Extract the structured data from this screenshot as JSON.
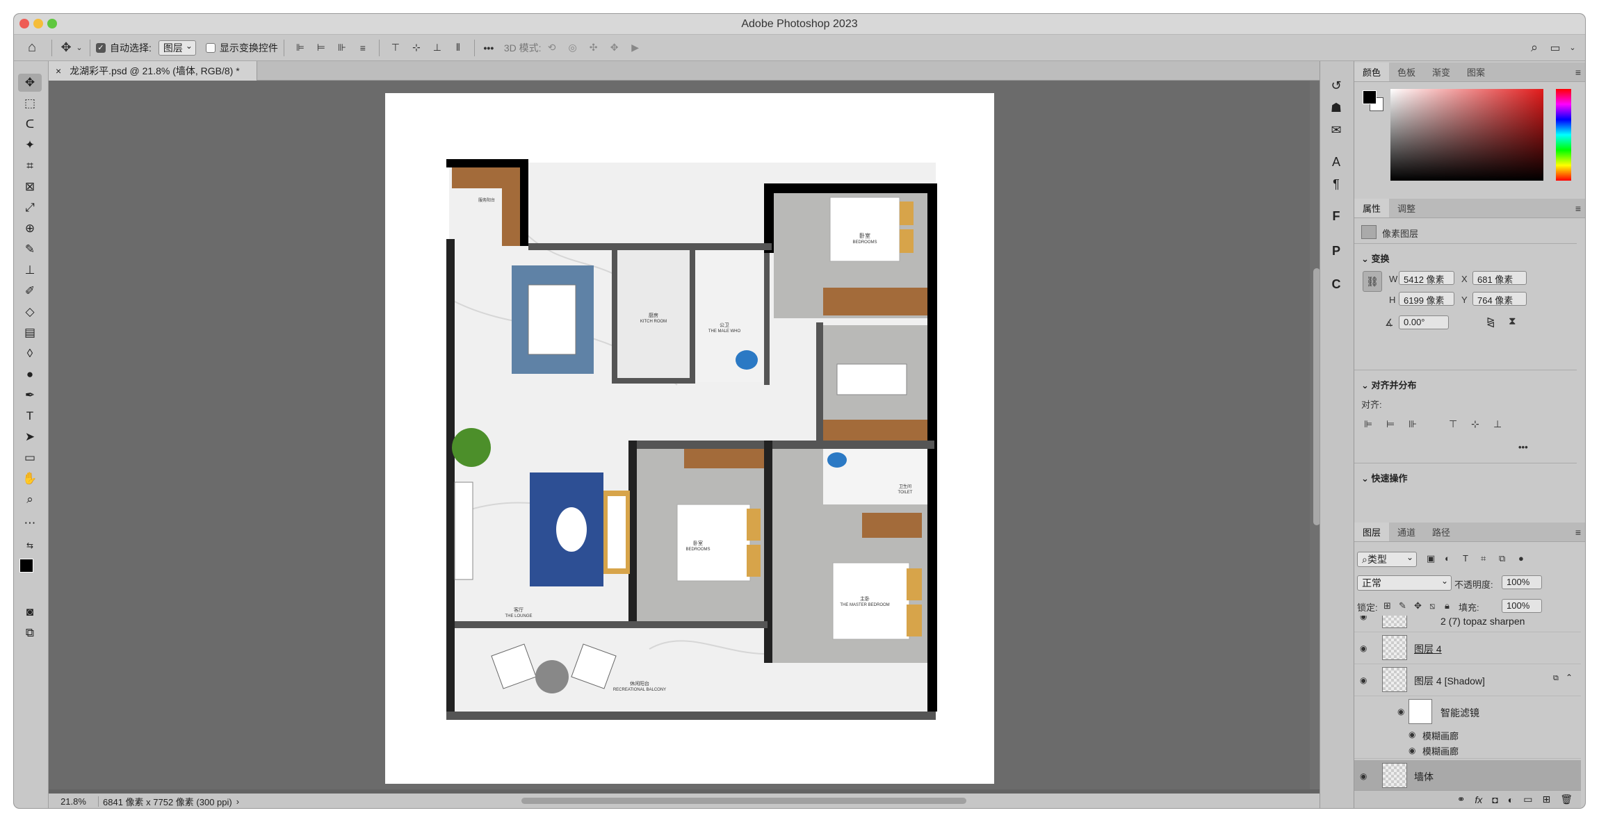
{
  "app": {
    "title": "Adobe Photoshop 2023"
  },
  "options_bar": {
    "auto_select_label": "自动选择:",
    "auto_select_value": "图层",
    "show_transform_label": "显示变换控件",
    "mode_3d_label": "3D 模式:",
    "more": "•••"
  },
  "document": {
    "tab_label": "龙湖彩平.psd @ 21.8% (墙体, RGB/8) *",
    "close": "×"
  },
  "status": {
    "zoom": "21.8%",
    "info": "6841 像素 x 7752 像素 (300 ppi)"
  },
  "floorplan": {
    "rooms": [
      {
        "cn": "卧室",
        "en": "BEDROOMS"
      },
      {
        "cn": "厨房",
        "en": "KITCH ROOM"
      },
      {
        "cn": "公卫",
        "en": "THE MALE WHO"
      },
      {
        "cn": "卧室",
        "en": "BEDROOMS"
      },
      {
        "cn": "卫生间",
        "en": "TOILET"
      },
      {
        "cn": "主卧",
        "en": "THE MASTER BEDROOM"
      },
      {
        "cn": "客厅",
        "en": "THE LOUNGE"
      },
      {
        "cn": "休闲阳台",
        "en": "RECREATIONAL BALCONY"
      },
      {
        "cn": "服务阳台",
        "en": ""
      }
    ]
  },
  "color_panel": {
    "tabs": [
      "颜色",
      "色板",
      "渐变",
      "图案"
    ]
  },
  "properties_panel": {
    "tabs": [
      "属性",
      "调整"
    ],
    "layer_type": "像素图层",
    "transform_title": "变换",
    "w_label": "W",
    "w_value": "5412 像素",
    "h_label": "H",
    "h_value": "6199 像素",
    "x_label": "X",
    "x_value": "681 像素",
    "y_label": "Y",
    "y_value": "764 像素",
    "angle_value": "0.00°",
    "align_title": "对齐并分布",
    "align_label": "对齐:",
    "more": "•••",
    "quick_title": "快速操作"
  },
  "layers_panel": {
    "tabs": [
      "图层",
      "通道",
      "路径"
    ],
    "filter_kind": "类型",
    "blend_mode": "正常",
    "opacity_label": "不透明度:",
    "opacity_value": "100%",
    "lock_label": "锁定:",
    "fill_label": "填充:",
    "fill_value": "100%",
    "layers": [
      {
        "name": "2 (7) topaz sharpen"
      },
      {
        "name": "图层 4"
      },
      {
        "name": "图层 4 [Shadow]"
      },
      {
        "name": "智能滤镜"
      },
      {
        "name": "模糊画廊"
      },
      {
        "name": "模糊画廊"
      },
      {
        "name": "墙体"
      }
    ]
  }
}
